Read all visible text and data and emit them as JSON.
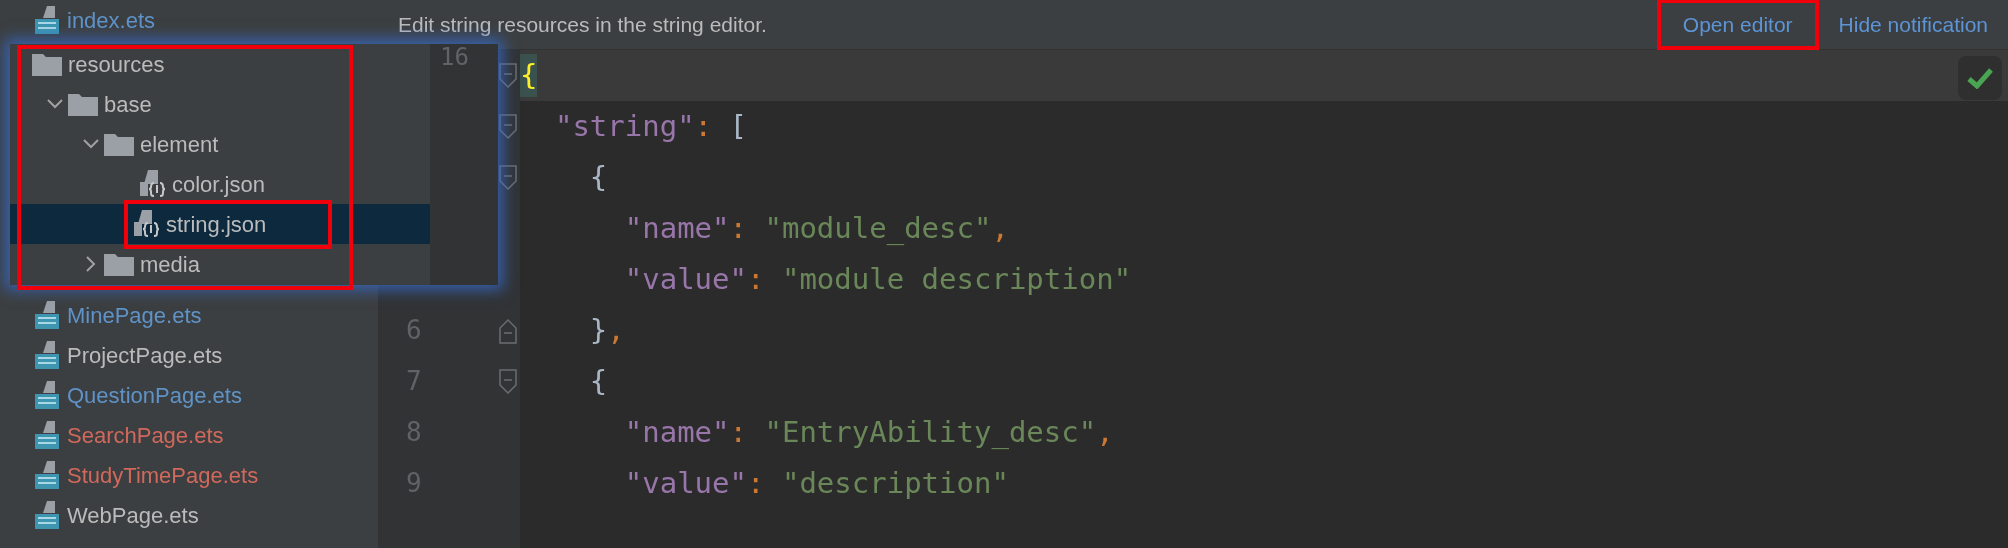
{
  "project_tree": {
    "items": [
      {
        "label": "index.ets",
        "color": "#5f93c8"
      },
      {
        "label": "MinePage.ets",
        "color": "#5f93c8"
      },
      {
        "label": "ProjectPage.ets",
        "color": "#bbbbbb"
      },
      {
        "label": "QuestionPage.ets",
        "color": "#5f93c8"
      },
      {
        "label": "SearchPage.ets",
        "color": "#d0695b"
      },
      {
        "label": "StudyTimePage.ets",
        "color": "#d0695b"
      },
      {
        "label": "WebPage.ets",
        "color": "#bbbbbb"
      }
    ]
  },
  "popup": {
    "annotated": true,
    "gutter_number": "16",
    "tree": [
      {
        "label": "resources",
        "kind": "folder",
        "selected": false,
        "children": [
          {
            "label": "base",
            "kind": "folder",
            "expanded": true,
            "selected": false,
            "children": [
              {
                "label": "element",
                "kind": "folder",
                "expanded": true,
                "selected": false,
                "children": [
                  {
                    "label": "color.json",
                    "kind": "json",
                    "selected": false,
                    "annotated": false
                  },
                  {
                    "label": "string.json",
                    "kind": "json",
                    "selected": true,
                    "annotated": true
                  }
                ]
              },
              {
                "label": "media",
                "kind": "folder",
                "expanded": false,
                "selected": false
              }
            ]
          }
        ]
      }
    ]
  },
  "notification": {
    "text": "Edit string resources in the string editor.",
    "actions": [
      {
        "label": "Open editor",
        "annotated": true
      },
      {
        "label": "Hide notification",
        "annotated": false
      }
    ]
  },
  "editor": {
    "inspection_ok": true,
    "lines": [
      {
        "text": "{",
        "current": true,
        "fold_open": true
      },
      {
        "text": "  \"string\": [",
        "current": false,
        "fold_open": true
      },
      {
        "text": "    {",
        "current": false,
        "fold_open": true
      },
      {
        "text": "      \"name\": \"module_desc\",",
        "current": false
      },
      {
        "text": "      \"value\": \"module description\"",
        "current": false
      },
      {
        "number": "6",
        "text": "    },",
        "current": false,
        "fold_close": true
      },
      {
        "number": "7",
        "text": "    {",
        "current": false,
        "fold_open": true
      },
      {
        "number": "8",
        "text": "      \"name\": \"EntryAbility_desc\",",
        "current": false
      },
      {
        "number": "9",
        "text": "      \"value\": \"description\"",
        "current": false
      }
    ]
  }
}
